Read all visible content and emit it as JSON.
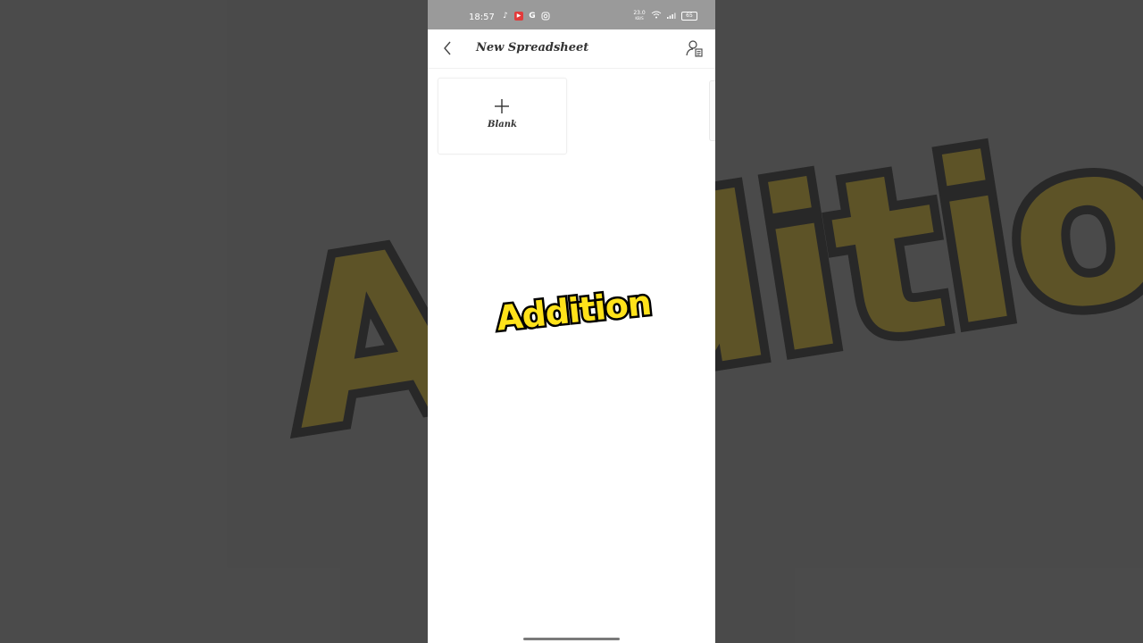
{
  "status_bar": {
    "time": "18:57",
    "left_icons": [
      "tiktok-icon",
      "app-red-icon",
      "google-icon",
      "instagram-icon"
    ],
    "net_speed_value": "23.0",
    "net_speed_unit": "KB/S",
    "battery": "65"
  },
  "app_bar": {
    "title": "New Spreadsheet",
    "back_icon": "chevron-left-icon",
    "account_icon": "account-document-icon"
  },
  "templates": [
    {
      "label": "Blank",
      "icon": "plus-icon"
    }
  ],
  "overlay": {
    "caption": "Addition",
    "background_text": "Addition",
    "caption_color": "#ffe21a",
    "caption_stroke": "#000000"
  },
  "colors": {
    "status_bar": "#9a9a9a",
    "page_background": "#4b4b4b",
    "screen_background": "#ffffff",
    "title_text": "#333333"
  }
}
